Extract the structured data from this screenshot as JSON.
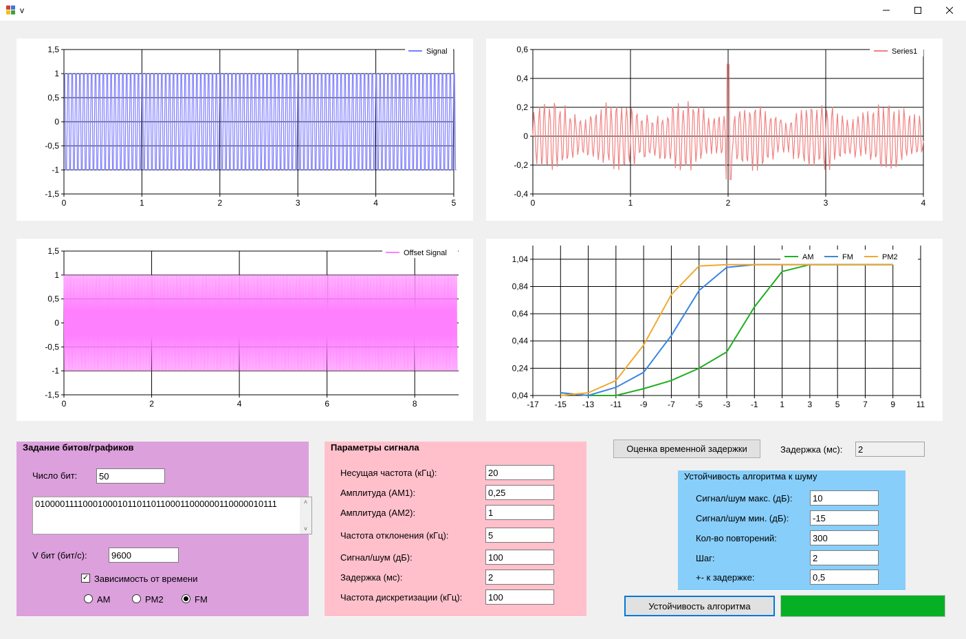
{
  "window": {
    "title": "v",
    "min_icon": "minimize-icon",
    "max_icon": "maximize-icon",
    "close_icon": "close-icon"
  },
  "charts": [
    {
      "id": "signal",
      "legend": [
        {
          "name": "Signal",
          "color": "#7b7bff"
        }
      ],
      "x_ticks": [
        "0",
        "1",
        "2",
        "3",
        "4",
        "5"
      ],
      "y_ticks": [
        "1,5",
        "1",
        "0,5",
        "0",
        "-0,5",
        "-1",
        "-1,5"
      ]
    },
    {
      "id": "series1",
      "legend": [
        {
          "name": "Series1",
          "color": "#f08080"
        }
      ],
      "x_ticks": [
        "0",
        "1",
        "2",
        "3",
        "4"
      ],
      "y_ticks": [
        "0,6",
        "0,4",
        "0,2",
        "0",
        "-0,2",
        "-0,4"
      ]
    },
    {
      "id": "offset",
      "legend": [
        {
          "name": "Offset Signal",
          "color": "#ff80ff"
        }
      ],
      "x_ticks": [
        "0",
        "2",
        "4",
        "6",
        "8"
      ],
      "y_ticks": [
        "1,5",
        "1",
        "0,5",
        "0",
        "-0,5",
        "-1",
        "-1,5"
      ]
    },
    {
      "id": "noise",
      "legend": [
        {
          "name": "AM",
          "color": "#1fae1f"
        },
        {
          "name": "FM",
          "color": "#3a86e0"
        },
        {
          "name": "PM2",
          "color": "#f0a830"
        }
      ],
      "x_ticks": [
        "-17",
        "-15",
        "-13",
        "-11",
        "-9",
        "-7",
        "-5",
        "-3",
        "-1",
        "1",
        "3",
        "5",
        "7",
        "9",
        "11"
      ],
      "y_ticks": [
        "1,04",
        "0,84",
        "0,64",
        "0,44",
        "0,24",
        "0,04"
      ]
    }
  ],
  "chart_data": [
    {
      "type": "line",
      "series": [
        {
          "name": "Signal",
          "description": "square-like oscillation between -1 and 1"
        }
      ],
      "xlim": [
        0,
        5
      ],
      "ylim": [
        -1.5,
        1.5
      ]
    },
    {
      "type": "line",
      "series": [
        {
          "name": "Series1",
          "description": "correlation oscillation with peak 0.5 at x=2"
        }
      ],
      "xlim": [
        0,
        4
      ],
      "ylim": [
        -0.4,
        0.6
      ]
    },
    {
      "type": "line",
      "series": [
        {
          "name": "Offset Signal",
          "description": "dense oscillation between -1 and 1"
        }
      ],
      "xlim": [
        0,
        9
      ],
      "ylim": [
        -1.5,
        1.5
      ]
    },
    {
      "type": "line",
      "x": [
        -15,
        -13,
        -11,
        -9,
        -7,
        -5,
        -3,
        -1,
        1,
        3,
        5,
        7,
        9
      ],
      "series": [
        {
          "name": "AM",
          "values": [
            0.06,
            0.04,
            0.04,
            0.09,
            0.15,
            0.24,
            0.36,
            0.69,
            0.95,
            1.0,
            1.0,
            1.0,
            1.0
          ]
        },
        {
          "name": "FM",
          "values": [
            0.06,
            0.04,
            0.1,
            0.21,
            0.48,
            0.81,
            0.98,
            1.0,
            1.0,
            1.0,
            1.0,
            1.0,
            1.0
          ]
        },
        {
          "name": "PM2",
          "values": [
            0.04,
            0.06,
            0.15,
            0.41,
            0.78,
            0.99,
            1.0,
            1.0,
            1.0,
            1.0,
            1.0,
            1.0,
            1.0
          ]
        }
      ],
      "xlim": [
        -17,
        11
      ],
      "ylim": [
        0.04,
        1.14
      ]
    }
  ],
  "bits_group": {
    "title": "Задание битов/графиков",
    "bits_count_label": "Число бит:",
    "bits_count_value": "50",
    "bits_string": "01000011110001000101101101100011000000110000010111",
    "rate_label": "V бит (бит/с):",
    "rate_value": "9600",
    "time_dep_label": "Зависимость от времени",
    "time_dep_checked": true,
    "modulations": [
      {
        "label": "AM",
        "selected": false
      },
      {
        "label": "PM2",
        "selected": false
      },
      {
        "label": "FM",
        "selected": true
      }
    ],
    "bg_color": "#dca0dc"
  },
  "signal_group": {
    "title": "Параметры сигнала",
    "fields": [
      {
        "label": "Несущая частота (кГц):",
        "value": "20"
      },
      {
        "label": "Амплитуда (АМ1):",
        "value": "0,25"
      },
      {
        "label": "Амплитуда (АМ2):",
        "value": "1"
      },
      {
        "label": "Частота отклонения (кГц):",
        "value": "5"
      },
      {
        "label": "Сигнал/шум (дБ):",
        "value": "100"
      },
      {
        "label": "Задержка (мс):",
        "value": "2"
      },
      {
        "label": "Частота дискретизации (кГц):",
        "value": "100"
      }
    ],
    "bg_color": "#ffc0cb"
  },
  "delay": {
    "button_label": "Оценка временной задержки",
    "label": "Задержка (мс):",
    "value": "2"
  },
  "noise_group": {
    "title": "Устойчивость алгоритма к шуму",
    "fields": [
      {
        "label": "Сигнал/шум макс. (дБ):",
        "value": "10"
      },
      {
        "label": "Сигнал/шум мин. (дБ):",
        "value": "-15"
      },
      {
        "label": "Кол-во повторений:",
        "value": "300"
      },
      {
        "label": "Шаг:",
        "value": "2"
      },
      {
        "label": "+- к задержке:",
        "value": "0,5"
      }
    ],
    "bg_color": "#87cefa"
  },
  "robustness": {
    "button_label": "Устойчивость алгоритма",
    "progress": 1.0,
    "progress_color": "#06b025"
  }
}
